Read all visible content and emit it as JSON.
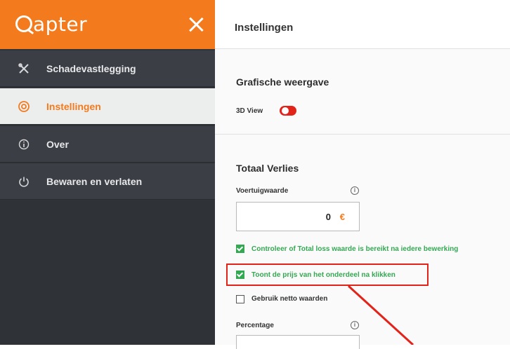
{
  "sidebar": {
    "logo": "apter",
    "items": [
      {
        "label": "Schadevastlegging",
        "icon": "tools-icon"
      },
      {
        "label": "Instellingen",
        "icon": "settings-icon",
        "active": true
      },
      {
        "label": "Over",
        "icon": "info-icon"
      },
      {
        "label": "Bewaren en verlaten",
        "icon": "power-icon"
      }
    ]
  },
  "header": {
    "title": "Instellingen"
  },
  "grafisch": {
    "title": "Grafische weergave",
    "view3d_label": "3D View"
  },
  "totaal": {
    "title": "Totaal Verlies",
    "voertuig_label": "Voertuigwaarde",
    "voertuig_value": "0",
    "currency": "€",
    "cb1_label": "Controleer of Total loss waarde is bereikt na iedere bewerking",
    "cb2_label": "Toont de prijs van het onderdeel na klikken",
    "cb3_label": "Gebruik netto waarden",
    "percentage_label": "Percentage"
  },
  "colors": {
    "accent": "#f37b1d",
    "sidebar": "#2f3237",
    "check": "#34a853",
    "highlight": "#e2231a"
  }
}
